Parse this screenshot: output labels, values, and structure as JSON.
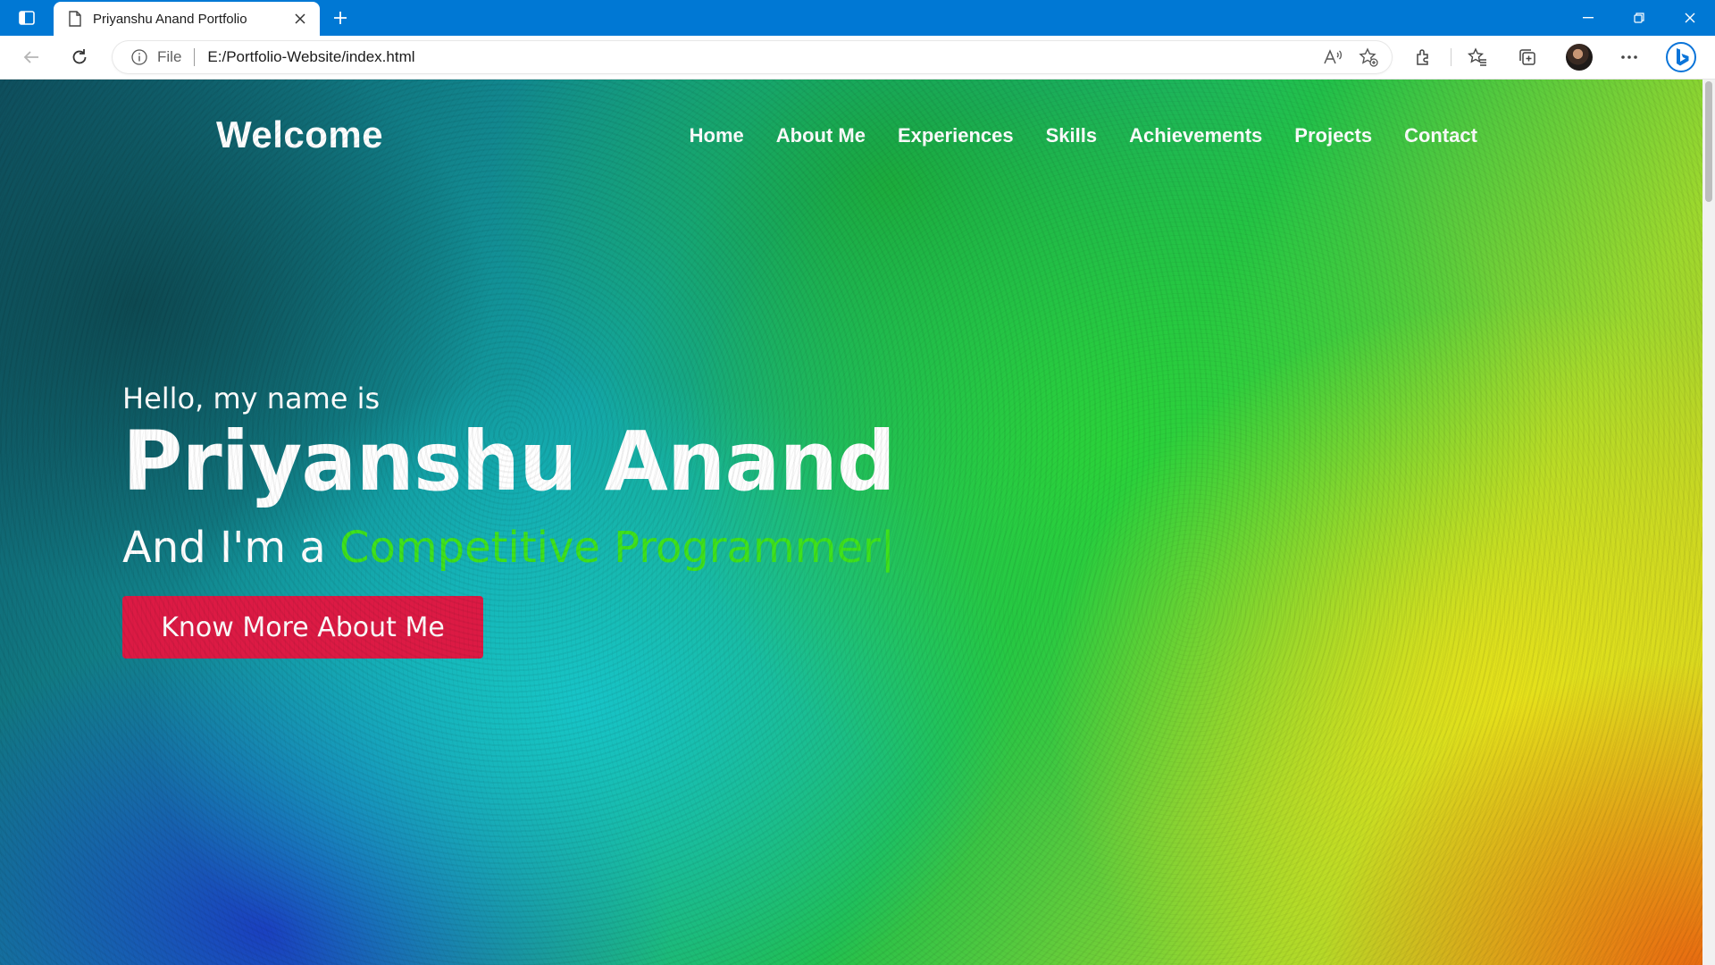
{
  "browser": {
    "tab": {
      "title": "Priyanshu Anand Portfolio"
    },
    "address": {
      "scheme": "File",
      "url": "E:/Portfolio-Website/index.html"
    }
  },
  "site": {
    "logo": "Welcome",
    "nav": [
      "Home",
      "About Me",
      "Experiences",
      "Skills",
      "Achievements",
      "Projects",
      "Contact"
    ],
    "hero": {
      "greeting": "Hello, my name is",
      "name": "Priyanshu Anand",
      "prefix": "And I'm a ",
      "role": "Competitive Programmer",
      "cursor": "|",
      "cta": "Know More About Me"
    }
  },
  "colors": {
    "browser_accent": "#0078d4",
    "role_text": "#3fe21c",
    "cta_background": "#dc1a44"
  }
}
